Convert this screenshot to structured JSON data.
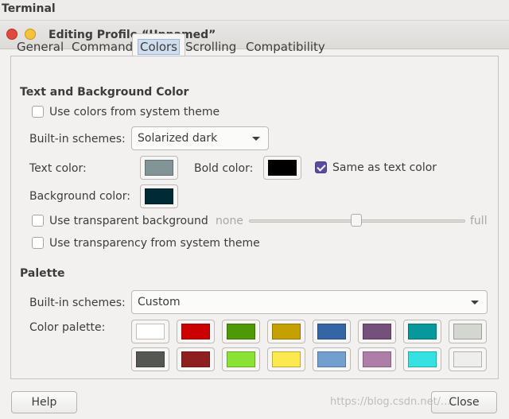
{
  "app": {
    "title": "Terminal"
  },
  "dialog": {
    "title": "Editing Profile “Unnamed”"
  },
  "tabs": [
    {
      "label": "General"
    },
    {
      "label": "Command"
    },
    {
      "label": "Colors",
      "active": true
    },
    {
      "label": "Scrolling"
    },
    {
      "label": "Compatibility"
    }
  ],
  "text_bg": {
    "title": "Text and Background Color",
    "use_system_colors": {
      "label": "Use colors from system theme",
      "checked": false
    },
    "builtin_label": "Built-in schemes:",
    "builtin_value": "Solarized dark",
    "text_color_label": "Text color:",
    "text_color": "#839496",
    "bold_color_label": "Bold color:",
    "bold_color": "#000000",
    "same_as_text": {
      "label": "Same as text color",
      "checked": true
    },
    "bg_color_label": "Background color:",
    "bg_color": "#002b36",
    "transparent_bg": {
      "label": "Use transparent background",
      "checked": false
    },
    "slider_min": "none",
    "slider_max": "full",
    "slider_value": 0.5,
    "transparency_system": {
      "label": "Use transparency from system theme",
      "checked": false
    }
  },
  "palette": {
    "title": "Palette",
    "builtin_label": "Built-in schemes:",
    "builtin_value": "Custom",
    "palette_label": "Color palette:",
    "row1": [
      "#ffffff",
      "#cc0000",
      "#4e9a06",
      "#c4a000",
      "#3465a4",
      "#75507b",
      "#06989a",
      "#d3d7cf"
    ],
    "row2": [
      "#555753",
      "#8f1e1e",
      "#8ae234",
      "#fce94f",
      "#729fcf",
      "#ad7fa8",
      "#34e2e2",
      "#eeeeec"
    ]
  },
  "buttons": {
    "help": "Help",
    "close": "Close"
  },
  "watermark": "https://blog.csdn.net/..."
}
